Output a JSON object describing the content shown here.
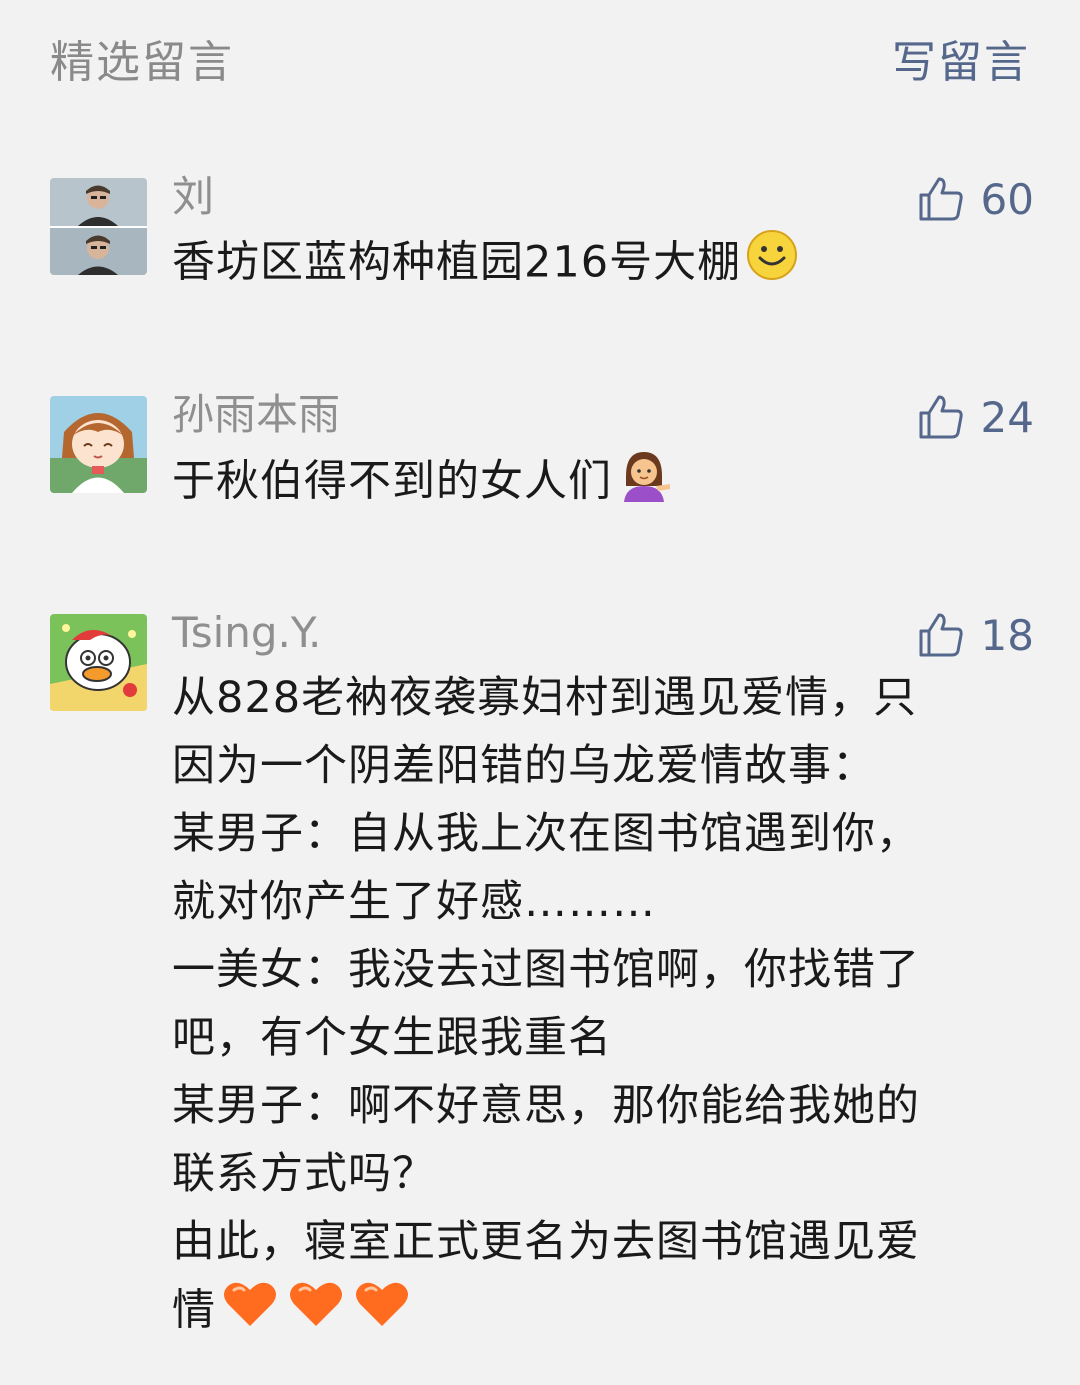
{
  "header": {
    "title": "精选留言",
    "write_label": "写留言"
  },
  "comments": [
    {
      "name": "刘",
      "text": "香坊区蓝构种植园216号大棚",
      "likes": "60",
      "emoji": "smile-emoji"
    },
    {
      "name": "孙雨本雨",
      "text": "于秋伯得不到的女人们",
      "likes": "24",
      "emoji": "woman-tipping-hand-emoji"
    },
    {
      "name": "Tsing.Y.",
      "text": "从828老衲夜袭寡妇村到遇见爱情，只\n因为一个阴差阳错的乌龙爱情故事：\n某男子：自从我上次在图书馆遇到你，\n就对你产生了好感………\n一美女：我没去过图书馆啊，你找错了\n吧，有个女生跟我重名\n某男子：啊不好意思，那你能给我她的\n联系方式吗？\n由此，寝室正式更名为去图书馆遇见爱\n情",
      "likes": "18",
      "emoji": "heart-emoji"
    }
  ],
  "colors": {
    "background": "#f2f2f2",
    "name": "#8f8f8f",
    "accent": "#55688c",
    "text": "#1a1a1a"
  }
}
